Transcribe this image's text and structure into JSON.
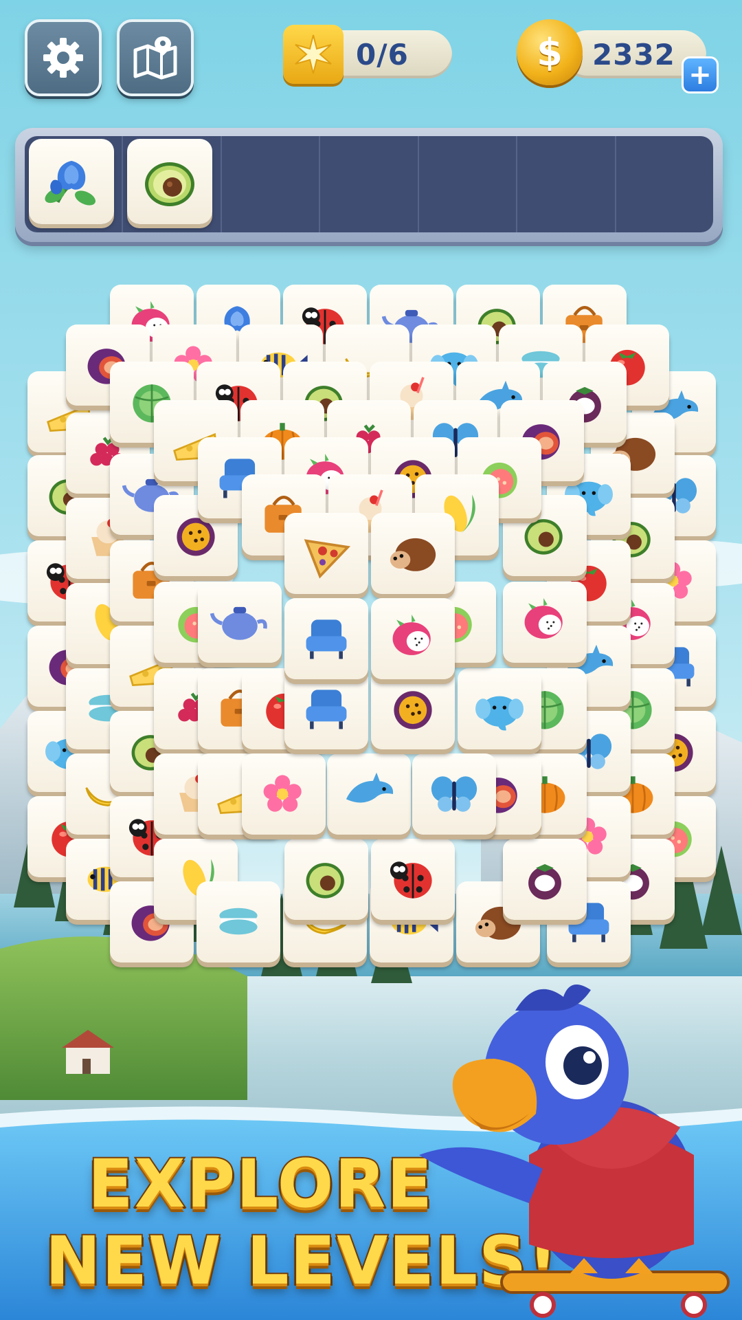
{
  "hud": {
    "settings_icon": "gear-icon",
    "map_icon": "map-icon",
    "goal_counter": "0/6",
    "goal_icon": "sparkle-star-icon",
    "coins": "2332",
    "coin_symbol": "$",
    "add_coins_symbol": "+"
  },
  "tray": {
    "slots": [
      {
        "item": "blue-flower"
      },
      {
        "item": "avocado"
      },
      {
        "item": ""
      },
      {
        "item": ""
      },
      {
        "item": ""
      },
      {
        "item": ""
      },
      {
        "item": ""
      }
    ]
  },
  "promo": {
    "line1": "EXPLORE",
    "line2": "NEW LEVELS!"
  },
  "mascot": "blue-parrot-on-skateboard",
  "colors": {
    "tray_bg": "#3f4d72",
    "tile_face": "#fffdf7",
    "promo_text": "#ffd94a",
    "water": "#3fa3e6"
  },
  "board": {
    "layers": [
      [
        "dragonfruit",
        "blue-flower",
        "ladybug",
        "teapot",
        "avocado",
        "handbag"
      ],
      [
        "fig",
        "pink-flower",
        "tropical-fish",
        "banana",
        "elephant",
        "macaron",
        "tomato"
      ],
      [
        "cabbage",
        "ladybug",
        "avocado",
        "sundae",
        "dolphin",
        "mangosteen"
      ],
      [
        "cheese",
        "pumpkin",
        "raspberry",
        "butterfly",
        "fig"
      ],
      [
        "armchair",
        "dragonfruit",
        "passionfruit",
        "guava"
      ],
      [
        "handbag",
        "sundae",
        "corn"
      ],
      [
        "pizza",
        "hedgehog",
        "armchair",
        "dragonfruit"
      ]
    ]
  }
}
